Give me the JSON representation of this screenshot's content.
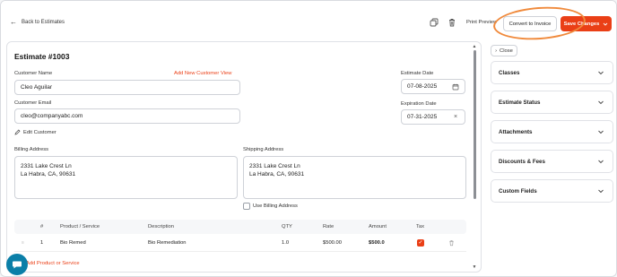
{
  "topbar": {
    "back_label": "Back to Estimates",
    "print_label": "Print Preview",
    "convert_label": "Convert to Invoice",
    "save_label": "Save Changes"
  },
  "estimate": {
    "title": "Estimate #1003",
    "customer_name_label": "Customer Name",
    "add_new_customer": "Add New Customer",
    "view_link": "View",
    "customer_name": "Cleo Aguilar",
    "customer_email_label": "Customer Email",
    "customer_email": "cleo@companyabc.com",
    "edit_customer": "Edit Customer",
    "estimate_date_label": "Estimate Date",
    "estimate_date": "07-08-2025",
    "expiration_date_label": "Expiration Date",
    "expiration_date": "07-31-2025",
    "billing_label": "Billing Address",
    "billing_line1": "2331 Lake Crest Ln",
    "billing_line2": "La Habra, CA, 90631",
    "shipping_label": "Shipping Address",
    "shipping_line1": "2331 Lake Crest Ln",
    "shipping_line2": "La Habra, CA, 90631",
    "use_billing": "Use Billing Address"
  },
  "table": {
    "headers": [
      "#",
      "Product / Service",
      "Description",
      "QTY",
      "Rate",
      "Amount",
      "Tax"
    ],
    "rows": [
      {
        "num": "1",
        "product": "Bio Remed",
        "description": "Bio Remediation",
        "qty": "1.0",
        "rate": "$500.00",
        "amount": "$500.0",
        "tax": true
      }
    ],
    "add_line": "Add Product or Service"
  },
  "panel": {
    "close_label": "Close",
    "sections": [
      "Classes",
      "Estimate Status",
      "Attachments",
      "Discounts & Fees",
      "Custom Fields"
    ]
  },
  "colors": {
    "accent": "#ea3f16",
    "highlight_ring": "#f08a3c",
    "chat": "#0b7fa8"
  }
}
